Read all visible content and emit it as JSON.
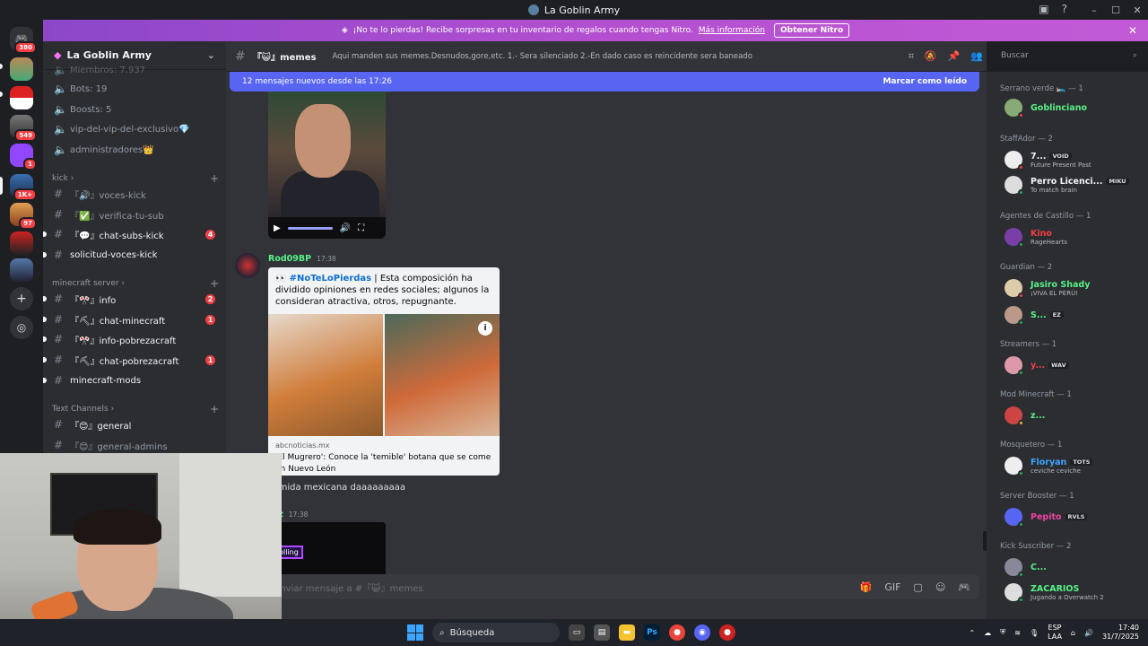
{
  "window": {
    "title": "La Goblin Army"
  },
  "guild_badges": [
    "380",
    "549",
    "1",
    "1K+",
    "97"
  ],
  "banner": {
    "text": "¡No te lo pierdas! Recibe sorpresas en tu inventario de regalos cuando tengas Nitro.",
    "link": "Más información",
    "button": "Obtener Nitro"
  },
  "server": {
    "name": "La Goblin Army"
  },
  "sidebar": {
    "partial_top": "Miembros: 7.937",
    "stats": [
      "Bots: 19",
      "Boosts: 5",
      "vip-del-vip-del-exclusivo💎",
      "administradores👑"
    ],
    "cat_kick": "kick",
    "kick_channels": [
      {
        "name": "『🔊』voces-kick",
        "count": ""
      },
      {
        "name": "『✅』verifica-tu-sub",
        "count": ""
      },
      {
        "name": "『💬』chat-subs-kick",
        "count": "4"
      },
      {
        "name": "solicitud-voces-kick",
        "count": ""
      }
    ],
    "cat_mc": "minecraft server",
    "mc_channels": [
      {
        "name": "『🎌』info",
        "count": "2"
      },
      {
        "name": "『⛏』chat-minecraft",
        "count": "1"
      },
      {
        "name": "『🎌』info-pobrezacraft",
        "count": ""
      },
      {
        "name": "『⛏』chat-pobrezacraft",
        "count": "1"
      },
      {
        "name": "minecraft-mods",
        "count": ""
      }
    ],
    "cat_text": "Text Channels",
    "text_channels": [
      {
        "name": "『😊』general",
        "count": ""
      },
      {
        "name": "『😊』general-admins",
        "count": ""
      }
    ]
  },
  "channel": {
    "name": "『😺』memes",
    "topic": "Aqui manden sus memes.Desnudos,gore,etc. 1.- Sera silenciado 2.-En dado caso es reincidente sera baneado"
  },
  "search": {
    "placeholder": "Buscar"
  },
  "newbar": {
    "text": "12 mensajes nuevos desde las 17:26",
    "mark": "Marcar como leído"
  },
  "messages": {
    "m1_author": "Rod09BP",
    "m1_time": "17:38",
    "embed_tag": "#NoTeLoPierdas",
    "embed_text": "|  Esta composición ha dividido opiniones en redes sociales; algunos la consideran atractiva, otros, repugnante.",
    "embed_source": "abcnoticias.mx",
    "embed_headline": "'El Mugrero': Conoce la 'temible' botana que se come en Nuevo León",
    "m1_text": "comida mexicana daaaaaaaaa",
    "m2_author": "roz",
    "m2_time": "17:38",
    "m2_img_label": "rolling"
  },
  "composer": {
    "placeholder": "Enviar mensaje a #『😺』memes"
  },
  "members": {
    "groups": [
      {
        "title": "Serrano verde 🛌 — 1"
      },
      {
        "title": "StaffAdor — 2"
      },
      {
        "title": "Agentes de Castillo — 1"
      },
      {
        "title": "Guardian — 2"
      },
      {
        "title": "Streamers — 1"
      },
      {
        "title": "Mod Minecraft — 1"
      },
      {
        "title": "Mosquetero — 1"
      },
      {
        "title": "Server Booster — 1"
      },
      {
        "title": "Kick Suscriber — 2"
      }
    ],
    "list": [
      {
        "name": "Goblinciano",
        "tag": "",
        "sub": "",
        "color": "#57f287"
      },
      {
        "name": "7...",
        "tag": "VOID",
        "sub": "Future Present Past",
        "color": "#f2f3f5"
      },
      {
        "name": "Perro Licenci...",
        "tag": "MIKU",
        "sub": "To match brain",
        "color": "#f2f3f5"
      },
      {
        "name": "Kino",
        "tag": "",
        "sub": "RageHearts",
        "color": "#f23f43"
      },
      {
        "name": "Jasiro Shady",
        "tag": "",
        "sub": "¡VIVA EL PERÚ!",
        "color": "#57f287"
      },
      {
        "name": "S...",
        "tag": "EZ",
        "sub": "",
        "color": "#57f287"
      },
      {
        "name": "y...",
        "tag": "WAV",
        "sub": "",
        "color": "#f23f43"
      },
      {
        "name": "z...",
        "tag": "",
        "sub": "",
        "color": "#57f287"
      },
      {
        "name": "Floryan",
        "tag": "TOTS",
        "sub": "ceviche ceviche",
        "color": "#3ba5ff"
      },
      {
        "name": "Pepito",
        "tag": "RVLS",
        "sub": "",
        "color": "#eb459f"
      },
      {
        "name": "C...",
        "tag": "",
        "sub": "",
        "color": "#57f287"
      },
      {
        "name": "ZACARIOS",
        "tag": "",
        "sub": "Jugando a Overwatch 2",
        "color": "#57f287"
      }
    ]
  },
  "taskbar": {
    "search": "Búsqueda",
    "lang1": "ESP",
    "lang2": "LAA",
    "time": "17:40",
    "date": "31/7/2025"
  },
  "colors": {
    "accent": "#5865f2",
    "banner": "#b34fd0",
    "unread": "#f23f43"
  }
}
